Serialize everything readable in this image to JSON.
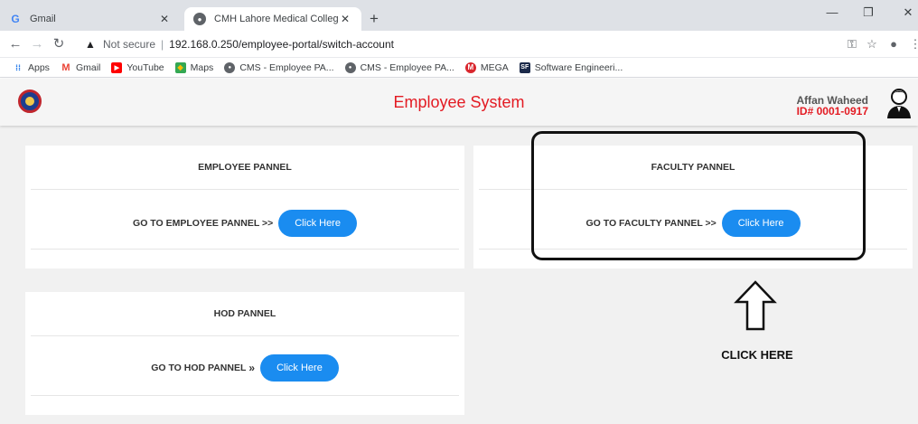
{
  "browser": {
    "tabs": [
      {
        "title": "Gmail",
        "favicon": "gmail-icon",
        "active": false
      },
      {
        "title": "CMH Lahore Medical College",
        "favicon": "globe-icon",
        "active": true
      }
    ],
    "address": {
      "security_label": "Not secure",
      "url": "192.168.0.250/employee-portal/switch-account"
    },
    "bookmarks": [
      {
        "label": "Apps",
        "icon": "apps-grid-icon",
        "color": "#1a73e8"
      },
      {
        "label": "Gmail",
        "icon": "gmail-icon",
        "color": "#ea4335"
      },
      {
        "label": "YouTube",
        "icon": "youtube-icon",
        "color": "#ff0000"
      },
      {
        "label": "Maps",
        "icon": "maps-icon",
        "color": "#34a853"
      },
      {
        "label": "CMS - Employee PA...",
        "icon": "globe-icon",
        "color": "#5f6368"
      },
      {
        "label": "CMS - Employee PA...",
        "icon": "globe-icon",
        "color": "#5f6368"
      },
      {
        "label": "MEGA",
        "icon": "mega-icon",
        "color": "#d9272e"
      },
      {
        "label": "Software Engineeri...",
        "icon": "sf-icon",
        "color": "#1b2a4a"
      }
    ]
  },
  "app": {
    "title": "Employee System",
    "accent_color": "#e31b23",
    "button_color": "#1a8cf0",
    "user": {
      "name": "Affan Waheed",
      "id": "ID# 0001-0917"
    }
  },
  "cards": {
    "employee": {
      "title": "EMPLOYEE PANNEL",
      "prompt": "GO TO EMPLOYEE PANNEL >>",
      "button": "Click Here"
    },
    "faculty": {
      "title": "FACULTY PANNEL",
      "prompt": "GO TO FACULTY PANNEL >>",
      "button": "Click Here"
    },
    "hod": {
      "title": "HOD PANNEL",
      "prompt": "GO TO HOD PANNEL",
      "prompt_icon": "double-chevron-right-icon",
      "button": "Click Here"
    }
  },
  "annotation": {
    "label": "CLICK HERE"
  }
}
